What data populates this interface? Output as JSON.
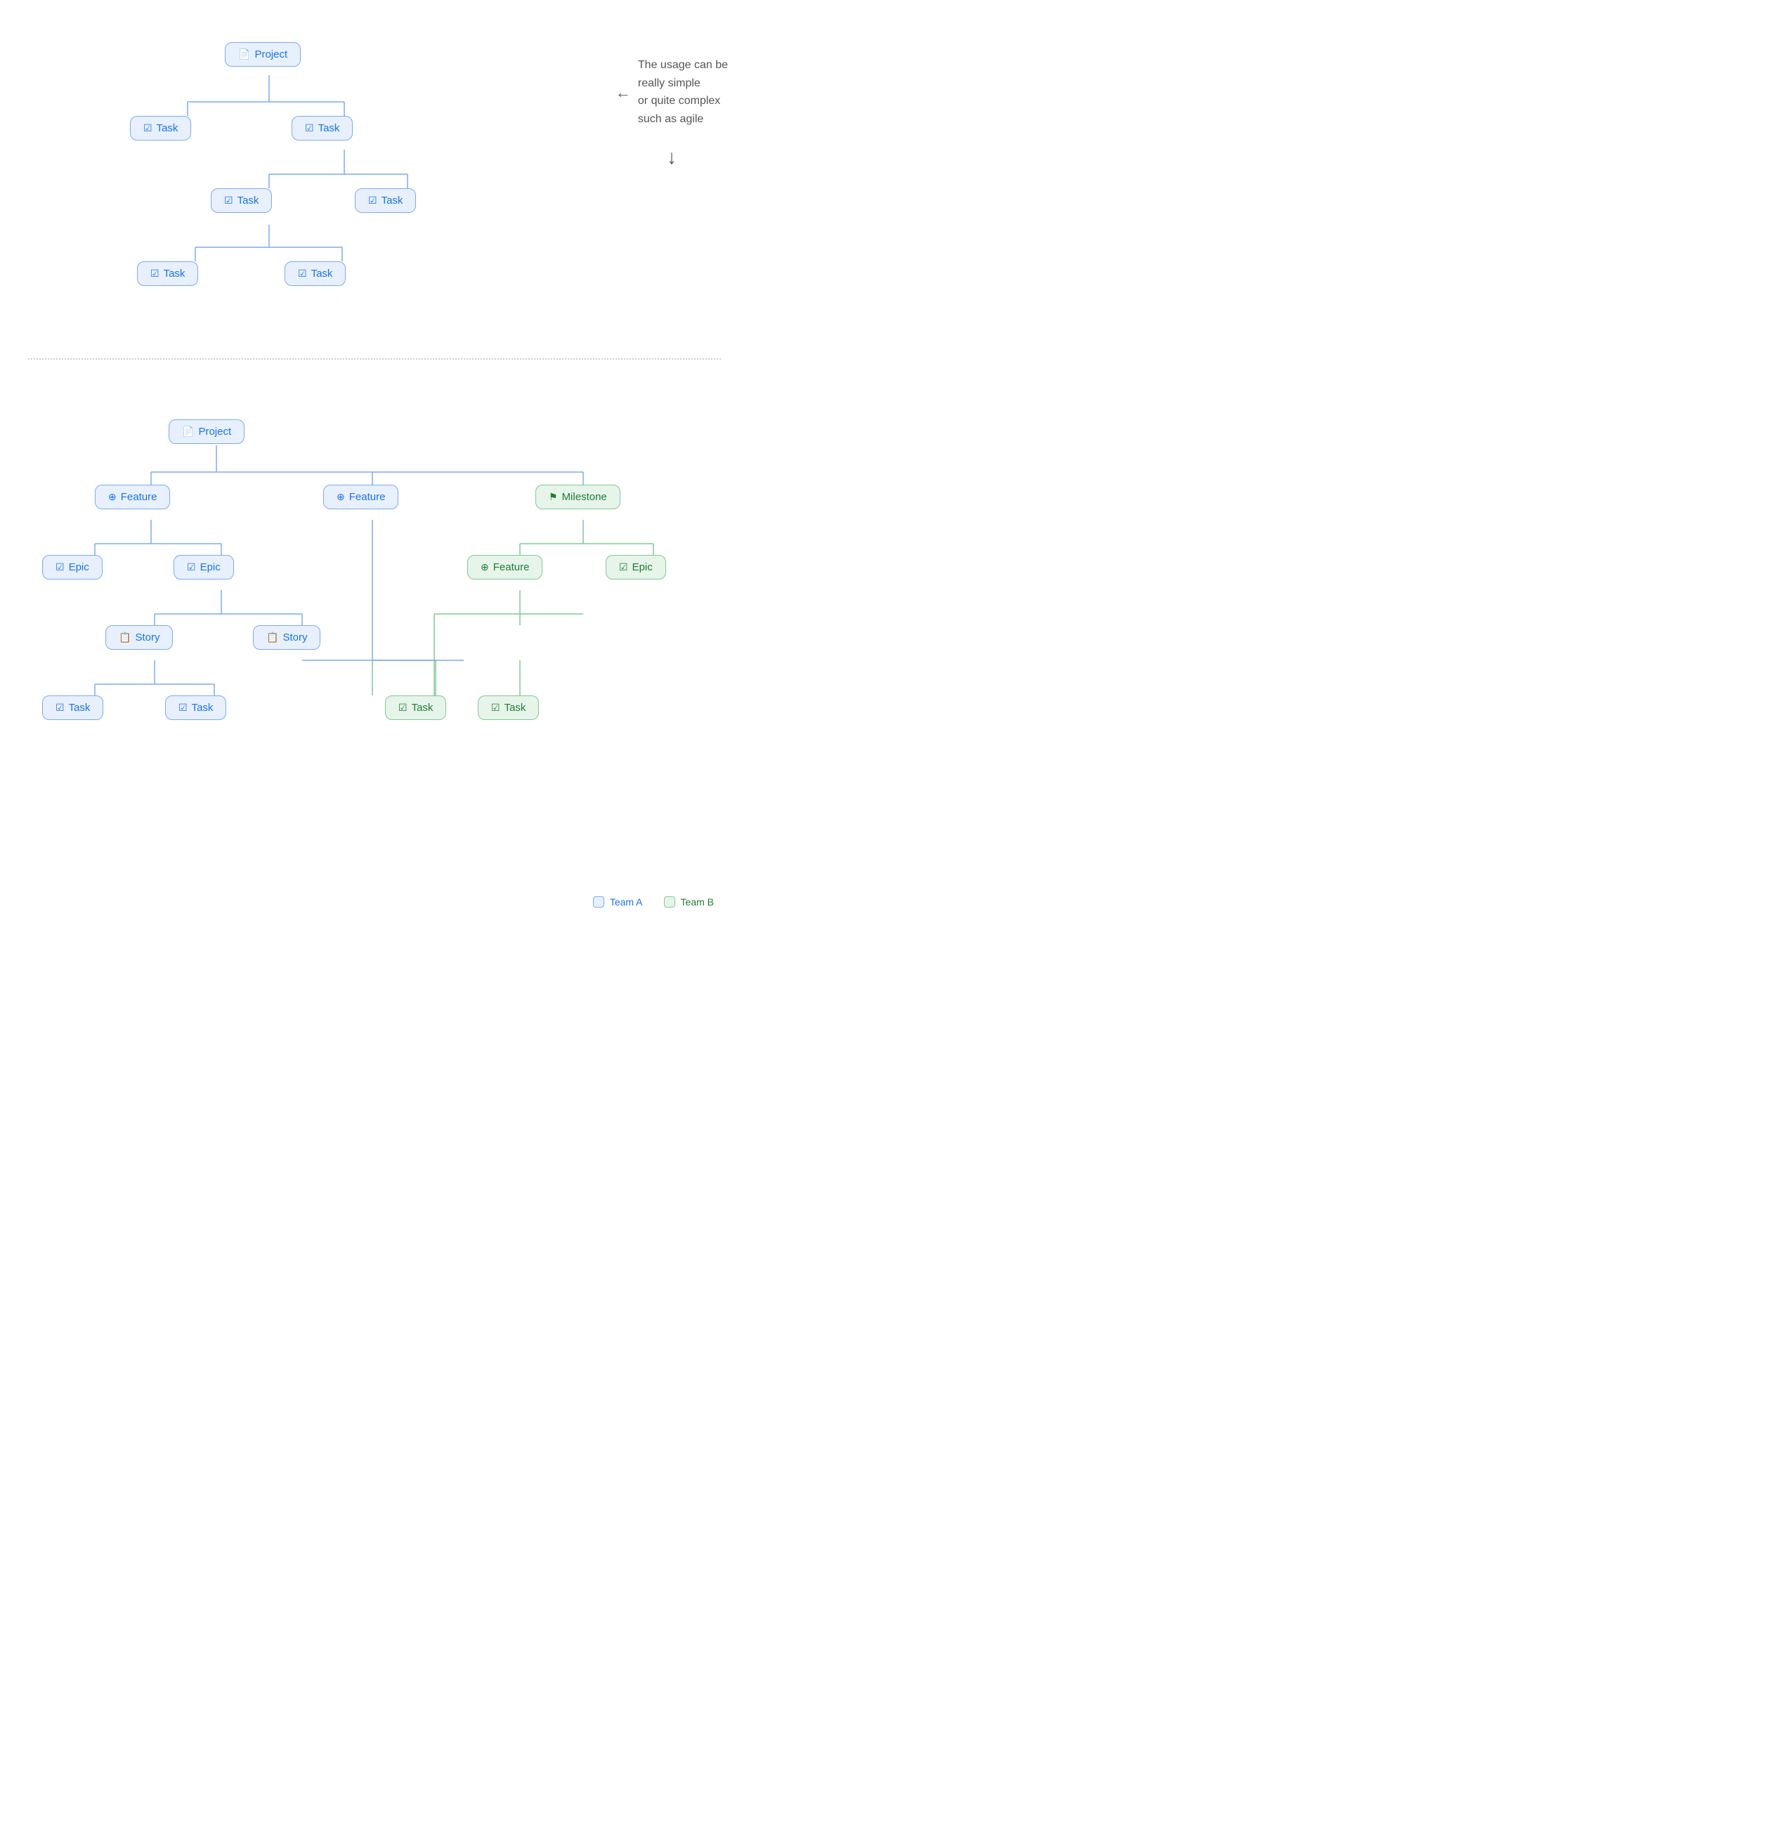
{
  "diagram1": {
    "nodes": {
      "project": {
        "label": "Project",
        "icon": "📄"
      },
      "task1": {
        "label": "Task",
        "icon": "✅"
      },
      "task2": {
        "label": "Task",
        "icon": "✅"
      },
      "task3": {
        "label": "Task",
        "icon": "✅"
      },
      "task4": {
        "label": "Task",
        "icon": "✅"
      },
      "task5": {
        "label": "Task",
        "icon": "✅"
      },
      "task6": {
        "label": "Task",
        "icon": "✅"
      }
    }
  },
  "diagram2": {
    "nodes": {
      "project": {
        "label": "Project",
        "icon": "📄"
      },
      "feature1": {
        "label": "Feature",
        "icon": "⊕"
      },
      "feature2": {
        "label": "Feature",
        "icon": "⊕"
      },
      "milestone": {
        "label": "Milestone",
        "icon": "⚑"
      },
      "epic1": {
        "label": "Epic",
        "icon": "✔"
      },
      "epic2": {
        "label": "Epic",
        "icon": "✔"
      },
      "story1": {
        "label": "Story",
        "icon": "📋"
      },
      "story2": {
        "label": "Story",
        "icon": "📋"
      },
      "task1": {
        "label": "Task",
        "icon": "✅"
      },
      "task2": {
        "label": "Task",
        "icon": "✅"
      },
      "feature3": {
        "label": "Feature",
        "icon": "⊕"
      },
      "epic3": {
        "label": "Epic",
        "icon": "✔"
      },
      "task3": {
        "label": "Task",
        "icon": "✅"
      },
      "task4": {
        "label": "Task",
        "icon": "✅"
      }
    }
  },
  "annotation": {
    "text1": "The usage can be",
    "text2": "really simple",
    "text3": "or quite complex",
    "text4": "such as agile"
  },
  "legend": {
    "teamA": "Team A",
    "teamB": "Team B"
  }
}
